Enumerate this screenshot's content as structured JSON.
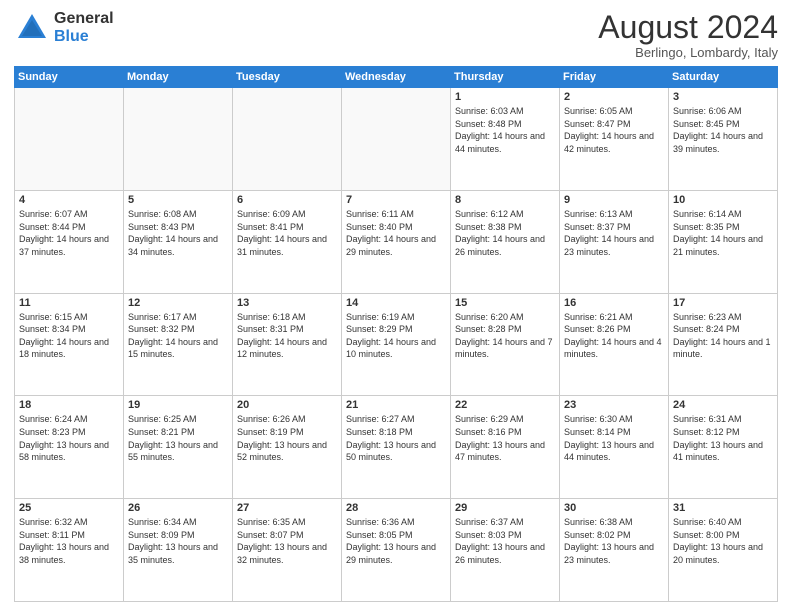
{
  "logo": {
    "general": "General",
    "blue": "Blue"
  },
  "title": "August 2024",
  "location": "Berlingo, Lombardy, Italy",
  "weekdays": [
    "Sunday",
    "Monday",
    "Tuesday",
    "Wednesday",
    "Thursday",
    "Friday",
    "Saturday"
  ],
  "weeks": [
    [
      {
        "day": "",
        "info": ""
      },
      {
        "day": "",
        "info": ""
      },
      {
        "day": "",
        "info": ""
      },
      {
        "day": "",
        "info": ""
      },
      {
        "day": "1",
        "info": "Sunrise: 6:03 AM\nSunset: 8:48 PM\nDaylight: 14 hours and 44 minutes."
      },
      {
        "day": "2",
        "info": "Sunrise: 6:05 AM\nSunset: 8:47 PM\nDaylight: 14 hours and 42 minutes."
      },
      {
        "day": "3",
        "info": "Sunrise: 6:06 AM\nSunset: 8:45 PM\nDaylight: 14 hours and 39 minutes."
      }
    ],
    [
      {
        "day": "4",
        "info": "Sunrise: 6:07 AM\nSunset: 8:44 PM\nDaylight: 14 hours and 37 minutes."
      },
      {
        "day": "5",
        "info": "Sunrise: 6:08 AM\nSunset: 8:43 PM\nDaylight: 14 hours and 34 minutes."
      },
      {
        "day": "6",
        "info": "Sunrise: 6:09 AM\nSunset: 8:41 PM\nDaylight: 14 hours and 31 minutes."
      },
      {
        "day": "7",
        "info": "Sunrise: 6:11 AM\nSunset: 8:40 PM\nDaylight: 14 hours and 29 minutes."
      },
      {
        "day": "8",
        "info": "Sunrise: 6:12 AM\nSunset: 8:38 PM\nDaylight: 14 hours and 26 minutes."
      },
      {
        "day": "9",
        "info": "Sunrise: 6:13 AM\nSunset: 8:37 PM\nDaylight: 14 hours and 23 minutes."
      },
      {
        "day": "10",
        "info": "Sunrise: 6:14 AM\nSunset: 8:35 PM\nDaylight: 14 hours and 21 minutes."
      }
    ],
    [
      {
        "day": "11",
        "info": "Sunrise: 6:15 AM\nSunset: 8:34 PM\nDaylight: 14 hours and 18 minutes."
      },
      {
        "day": "12",
        "info": "Sunrise: 6:17 AM\nSunset: 8:32 PM\nDaylight: 14 hours and 15 minutes."
      },
      {
        "day": "13",
        "info": "Sunrise: 6:18 AM\nSunset: 8:31 PM\nDaylight: 14 hours and 12 minutes."
      },
      {
        "day": "14",
        "info": "Sunrise: 6:19 AM\nSunset: 8:29 PM\nDaylight: 14 hours and 10 minutes."
      },
      {
        "day": "15",
        "info": "Sunrise: 6:20 AM\nSunset: 8:28 PM\nDaylight: 14 hours and 7 minutes."
      },
      {
        "day": "16",
        "info": "Sunrise: 6:21 AM\nSunset: 8:26 PM\nDaylight: 14 hours and 4 minutes."
      },
      {
        "day": "17",
        "info": "Sunrise: 6:23 AM\nSunset: 8:24 PM\nDaylight: 14 hours and 1 minute."
      }
    ],
    [
      {
        "day": "18",
        "info": "Sunrise: 6:24 AM\nSunset: 8:23 PM\nDaylight: 13 hours and 58 minutes."
      },
      {
        "day": "19",
        "info": "Sunrise: 6:25 AM\nSunset: 8:21 PM\nDaylight: 13 hours and 55 minutes."
      },
      {
        "day": "20",
        "info": "Sunrise: 6:26 AM\nSunset: 8:19 PM\nDaylight: 13 hours and 52 minutes."
      },
      {
        "day": "21",
        "info": "Sunrise: 6:27 AM\nSunset: 8:18 PM\nDaylight: 13 hours and 50 minutes."
      },
      {
        "day": "22",
        "info": "Sunrise: 6:29 AM\nSunset: 8:16 PM\nDaylight: 13 hours and 47 minutes."
      },
      {
        "day": "23",
        "info": "Sunrise: 6:30 AM\nSunset: 8:14 PM\nDaylight: 13 hours and 44 minutes."
      },
      {
        "day": "24",
        "info": "Sunrise: 6:31 AM\nSunset: 8:12 PM\nDaylight: 13 hours and 41 minutes."
      }
    ],
    [
      {
        "day": "25",
        "info": "Sunrise: 6:32 AM\nSunset: 8:11 PM\nDaylight: 13 hours and 38 minutes."
      },
      {
        "day": "26",
        "info": "Sunrise: 6:34 AM\nSunset: 8:09 PM\nDaylight: 13 hours and 35 minutes."
      },
      {
        "day": "27",
        "info": "Sunrise: 6:35 AM\nSunset: 8:07 PM\nDaylight: 13 hours and 32 minutes."
      },
      {
        "day": "28",
        "info": "Sunrise: 6:36 AM\nSunset: 8:05 PM\nDaylight: 13 hours and 29 minutes."
      },
      {
        "day": "29",
        "info": "Sunrise: 6:37 AM\nSunset: 8:03 PM\nDaylight: 13 hours and 26 minutes."
      },
      {
        "day": "30",
        "info": "Sunrise: 6:38 AM\nSunset: 8:02 PM\nDaylight: 13 hours and 23 minutes."
      },
      {
        "day": "31",
        "info": "Sunrise: 6:40 AM\nSunset: 8:00 PM\nDaylight: 13 hours and 20 minutes."
      }
    ]
  ]
}
